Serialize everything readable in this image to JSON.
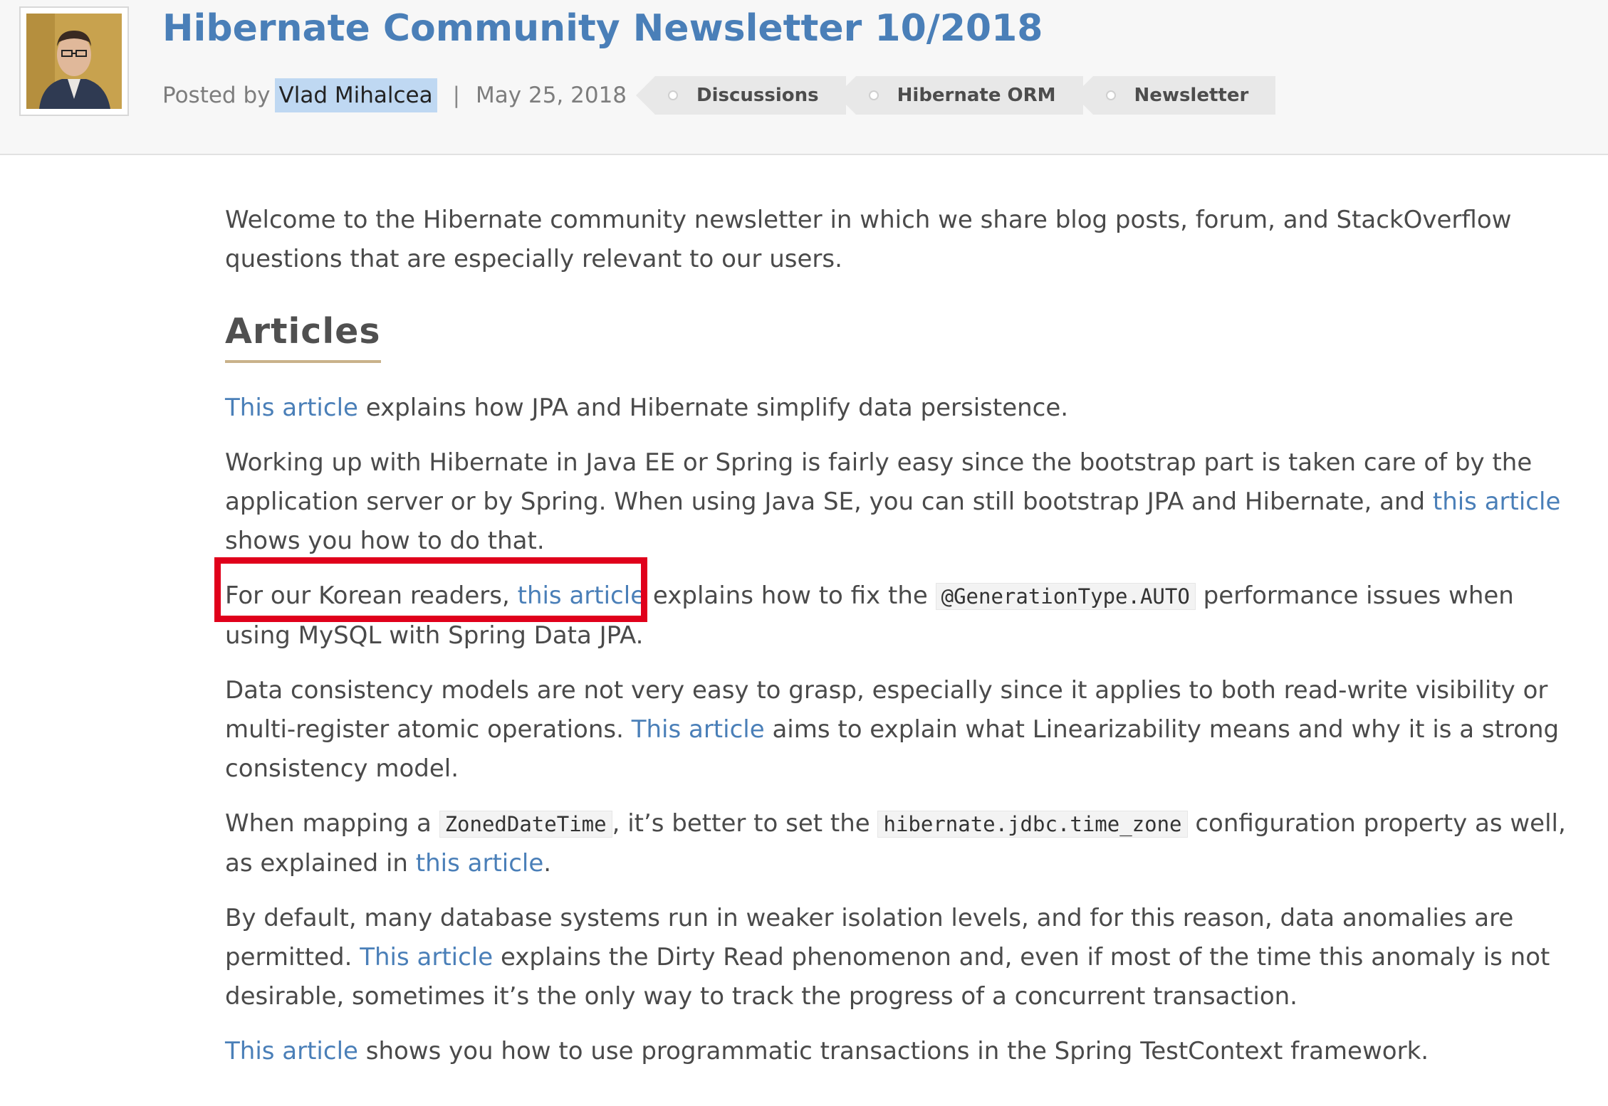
{
  "post": {
    "title": "Hibernate Community Newsletter 10/2018",
    "posted_by_label": "Posted by",
    "author": "Vlad Mihalcea",
    "separator": "|",
    "date": "May 25, 2018",
    "tags": [
      "Discussions",
      "Hibernate ORM",
      "Newsletter"
    ]
  },
  "content": {
    "intro": "Welcome to the Hibernate community newsletter in which we share blog posts, forum, and StackOverflow questions that are especially relevant to our users.",
    "section_heading": "Articles",
    "p1": {
      "link": "This article",
      "rest": " explains how JPA and Hibernate simplify data persistence."
    },
    "p2": {
      "before": "Working up with Hibernate in Java EE or Spring is fairly easy since the bootstrap part is taken care of by the application server or by Spring. When using Java SE, you can still bootstrap JPA and Hibernate, and ",
      "link": "this article",
      "after": " shows you how to do that."
    },
    "p3": {
      "before": "For our Korean readers, ",
      "link": "this article",
      "middle": " explains how to fix the ",
      "code": "@GenerationType.AUTO",
      "after": " performance issues when using MySQL with Spring Data JPA."
    },
    "p4": {
      "before": "Data consistency models are not very easy to grasp, especially since it applies to both read-write visibility or multi-register atomic operations. ",
      "link": "This article",
      "after": " aims to explain what Linearizability means and why it is a strong consistency model."
    },
    "p5": {
      "before": "When mapping a ",
      "code1": "ZonedDateTime",
      "middle": ", it’s better to set the ",
      "code2": "hibernate.jdbc.time_zone",
      "after": " configuration property as well, as explained in ",
      "link": "this article",
      "end": "."
    },
    "p6": {
      "before": "By default, many database systems run in weaker isolation levels, and for this reason, data anomalies are permitted. ",
      "link": "This article",
      "after": " explains the Dirty Read phenomenon and, even if most of the time this anomaly is not desirable, sometimes it’s the only way to track the progress of a concurrent transaction."
    },
    "p7": {
      "link": "This article",
      "rest": " shows you how to use programmatic transactions in the Spring TestContext framework."
    }
  },
  "colors": {
    "link": "#4a7fb8",
    "highlight_box": "#e0001b",
    "author_highlight": "#bfd8f2"
  }
}
